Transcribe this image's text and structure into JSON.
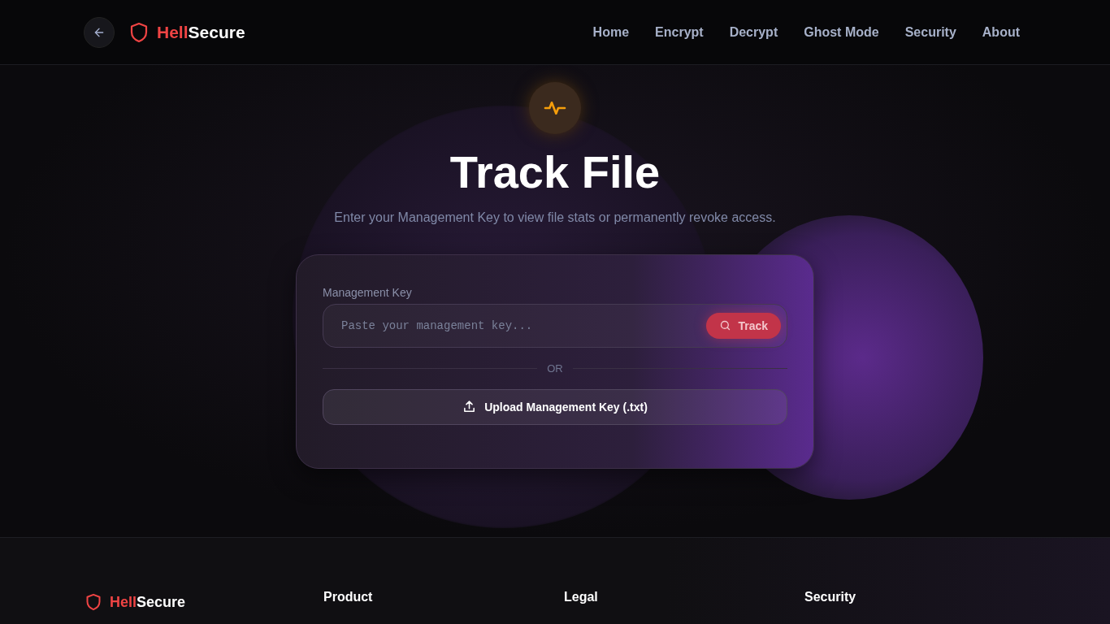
{
  "header": {
    "logo": {
      "accent": "Hell",
      "rest": "Secure"
    },
    "nav": [
      {
        "label": "Home"
      },
      {
        "label": "Encrypt"
      },
      {
        "label": "Decrypt"
      },
      {
        "label": "Ghost Mode"
      },
      {
        "label": "Security"
      },
      {
        "label": "About"
      }
    ]
  },
  "hero": {
    "title": "Track File",
    "subtitle": "Enter your Management Key to view file stats or permanently revoke access."
  },
  "form": {
    "label": "Management Key",
    "placeholder": "Paste your management key...",
    "track_button": "Track",
    "divider": "OR",
    "upload_button": "Upload Management Key (.txt)"
  },
  "footer": {
    "logo": {
      "accent": "Hell",
      "rest": "Secure"
    },
    "columns": [
      {
        "heading": "Product"
      },
      {
        "heading": "Legal"
      },
      {
        "heading": "Security"
      }
    ]
  }
}
